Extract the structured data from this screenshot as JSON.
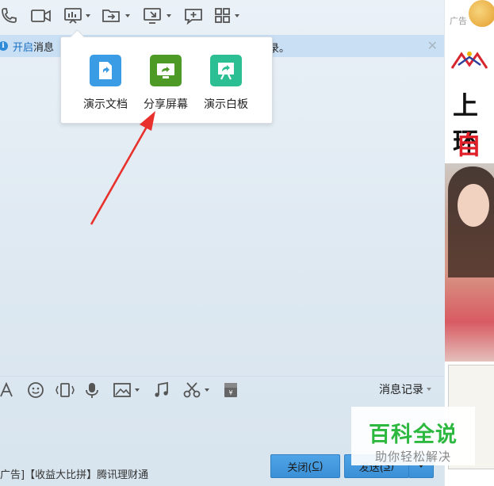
{
  "notice": {
    "text_prefix": "开启",
    "text_main": "消息",
    "text_tail": "录。"
  },
  "popup": {
    "items": [
      {
        "label": "演示文档",
        "icon": "document-share-icon",
        "color": "#3a9ce4"
      },
      {
        "label": "分享屏幕",
        "icon": "screen-share-icon",
        "color": "#4e9a27"
      },
      {
        "label": "演示白板",
        "icon": "whiteboard-icon",
        "color": "#2bbf93"
      }
    ]
  },
  "input_tools": {
    "history_label": "消息记录"
  },
  "footer": {
    "ad_text": "广告]【收益大比拼】腾讯理财通",
    "close_label": "关闭(",
    "close_key": "C",
    "close_suffix": ")",
    "send_label": "发送(",
    "send_key": "S",
    "send_suffix": ")"
  },
  "side_ad": {
    "tag": "广告",
    "line1": "上环",
    "line2": "自考"
  },
  "watermark": {
    "title": "百科全说",
    "subtitle": "助你轻松解决"
  },
  "colors": {
    "notice_bg": "#c9dff3",
    "accent": "#3b8fd6",
    "arrow": "#e8312c"
  }
}
